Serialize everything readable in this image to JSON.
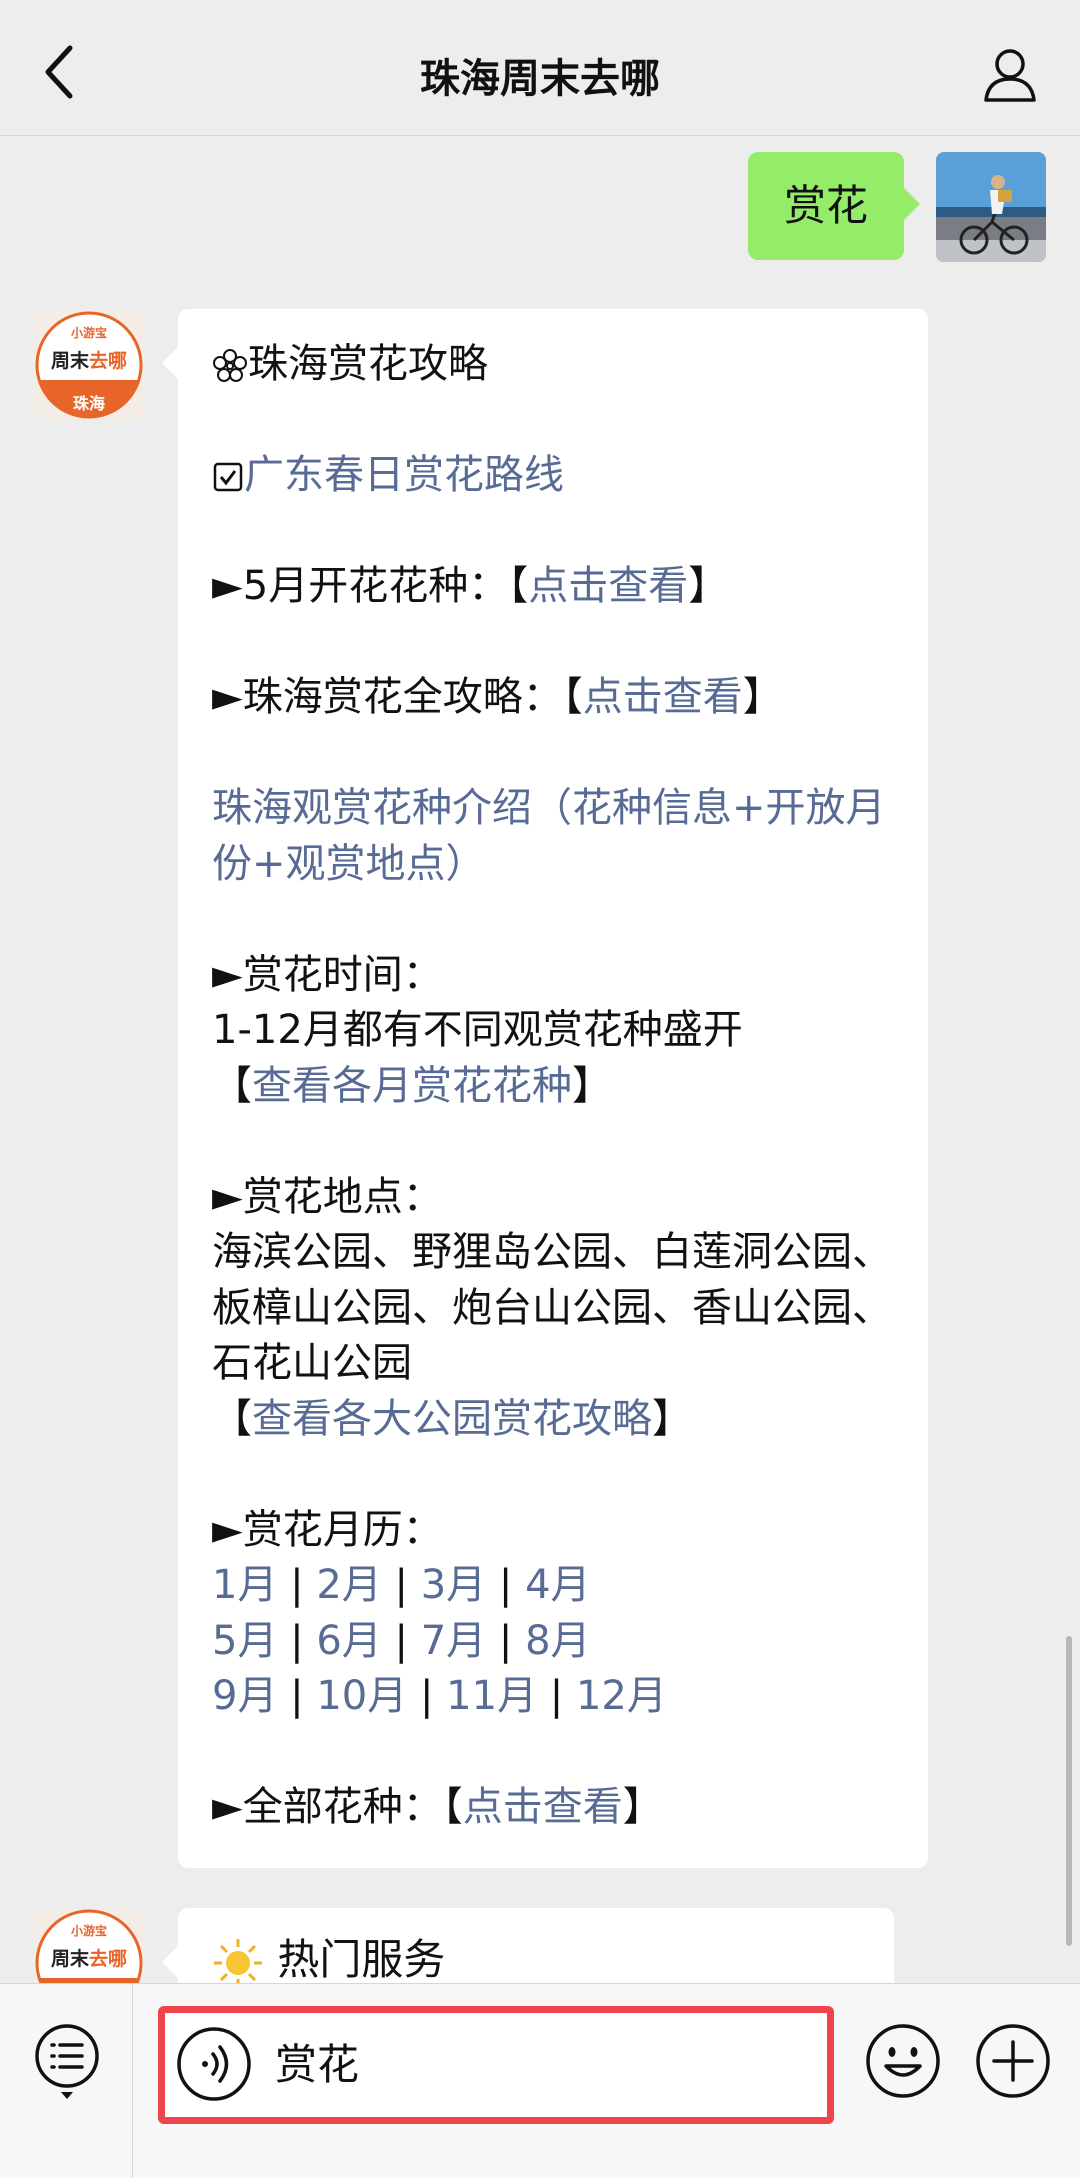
{
  "header": {
    "title": "珠海周末去哪"
  },
  "sent": {
    "text": "赏花"
  },
  "bot": {
    "avatar_top": "小游宝",
    "avatar_mid_a": "周末",
    "avatar_mid_b": "去哪",
    "avatar_bottom": "珠海"
  },
  "message": {
    "title": "珠海赏花攻略",
    "route_link": "广东春日赏花路线",
    "may_prefix": "►5月开花花种：【",
    "may_link": "点击查看",
    "may_suffix": "】",
    "guide_prefix": "►珠海赏花全攻略：【",
    "guide_link": "点击查看",
    "guide_suffix": "】",
    "intro_link": "珠海观赏花种介绍（花种信息+开放月份+观赏地点）",
    "time_label": "►赏花时间：",
    "time_text": "1-12月都有不同观赏花种盛开",
    "time_link_open": "【",
    "time_link": "查看各月赏花花种",
    "time_link_close": "】",
    "place_label": "►赏花地点：",
    "place_text": "海滨公园、野狸岛公园、白莲洞公园、板樟山公园、炮台山公园、香山公园、石花山公园",
    "place_link_open": "【",
    "place_link": "查看各大公园赏花攻略",
    "place_link_close": "】",
    "calendar_label": "►赏花月历：",
    "months_row1": [
      "1月",
      "2月",
      "3月",
      "4月"
    ],
    "months_row2": [
      "5月",
      "6月",
      "7月",
      "8月"
    ],
    "months_row3": [
      "9月",
      "10月",
      "11月",
      "12月"
    ],
    "month_sep": " | ",
    "all_prefix": "►全部花种：【",
    "all_link": "点击查看",
    "all_suffix": "】"
  },
  "message2": {
    "title": "热门服务"
  },
  "input": {
    "text": "赏花"
  },
  "colors": {
    "link": "#576b95",
    "sent_bubble": "#95ec69",
    "highlight": "#f0444d",
    "brand_orange": "#e8652a"
  }
}
